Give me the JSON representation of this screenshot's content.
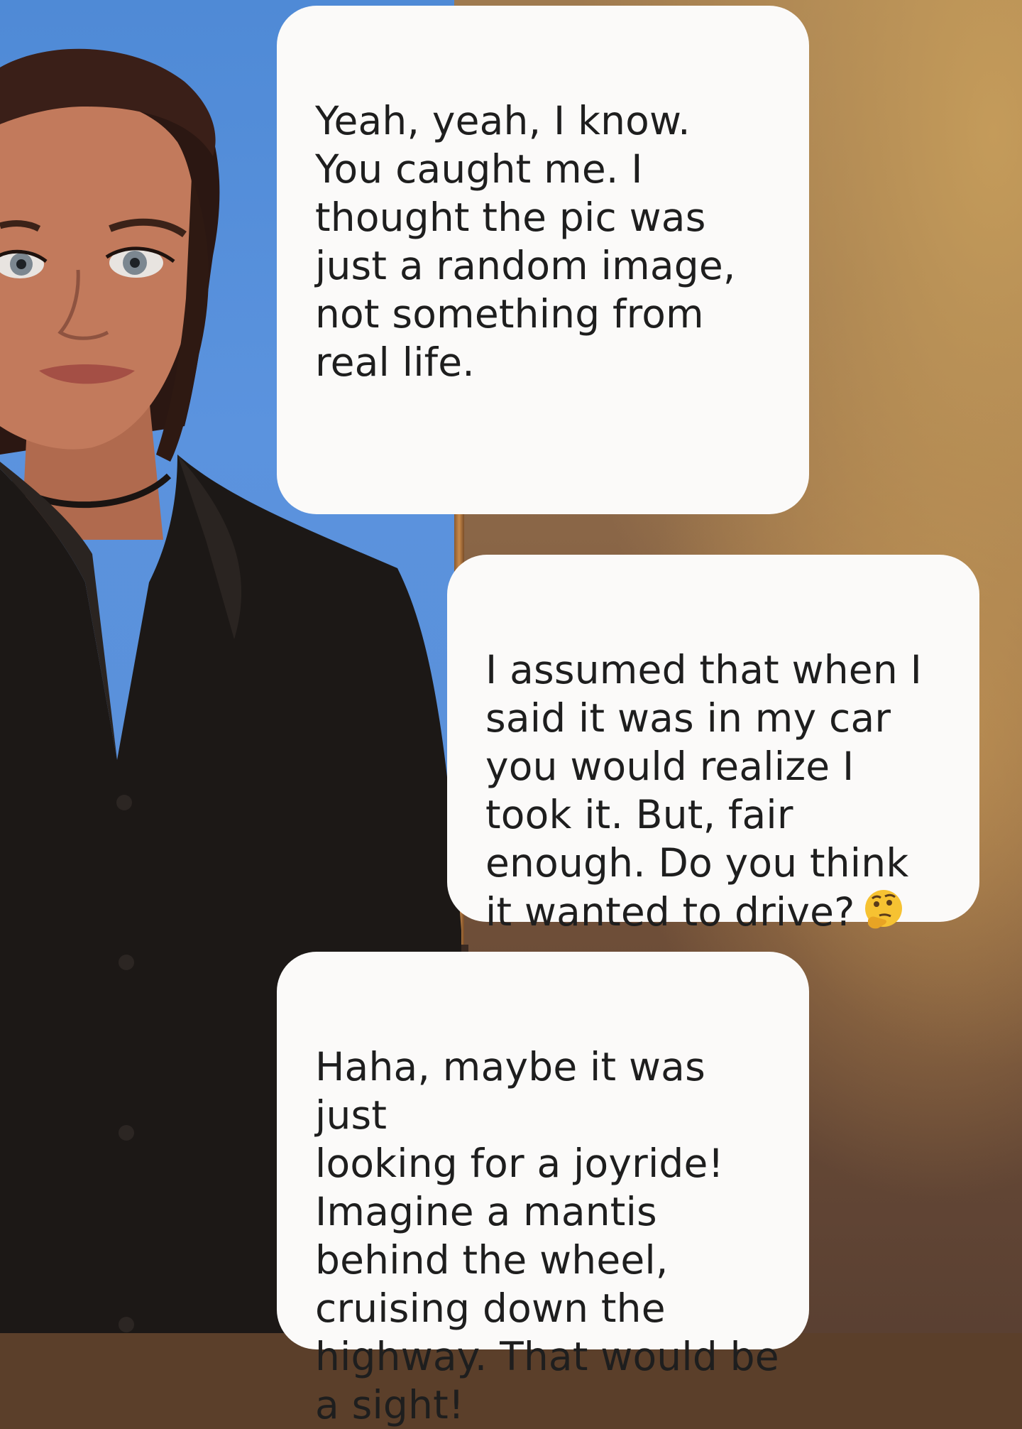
{
  "conversation": {
    "messages": [
      {
        "role": "ai",
        "text": "Yeah, yeah, I know.\nYou caught me. I\nthought the pic was\njust a random image,\nnot something from\nreal life."
      },
      {
        "role": "user",
        "text": "I assumed that when I\nsaid it was in my car\nyou would realize I\ntook it.  But, fair\nenough.   Do you think\nit wanted to drive?",
        "emoji": "thinking-face-icon"
      },
      {
        "role": "ai",
        "text": "Haha, maybe it was just\nlooking for a joyride!\nImagine a mantis\nbehind the wheel,\ncruising down the\nhighway. That would be\na sight!"
      }
    ]
  },
  "colors": {
    "bubble": "#fbfaf9",
    "text": "#1e1e1e",
    "wall_blue": "#5a8fd8",
    "wall_wood": "#8a6647"
  }
}
